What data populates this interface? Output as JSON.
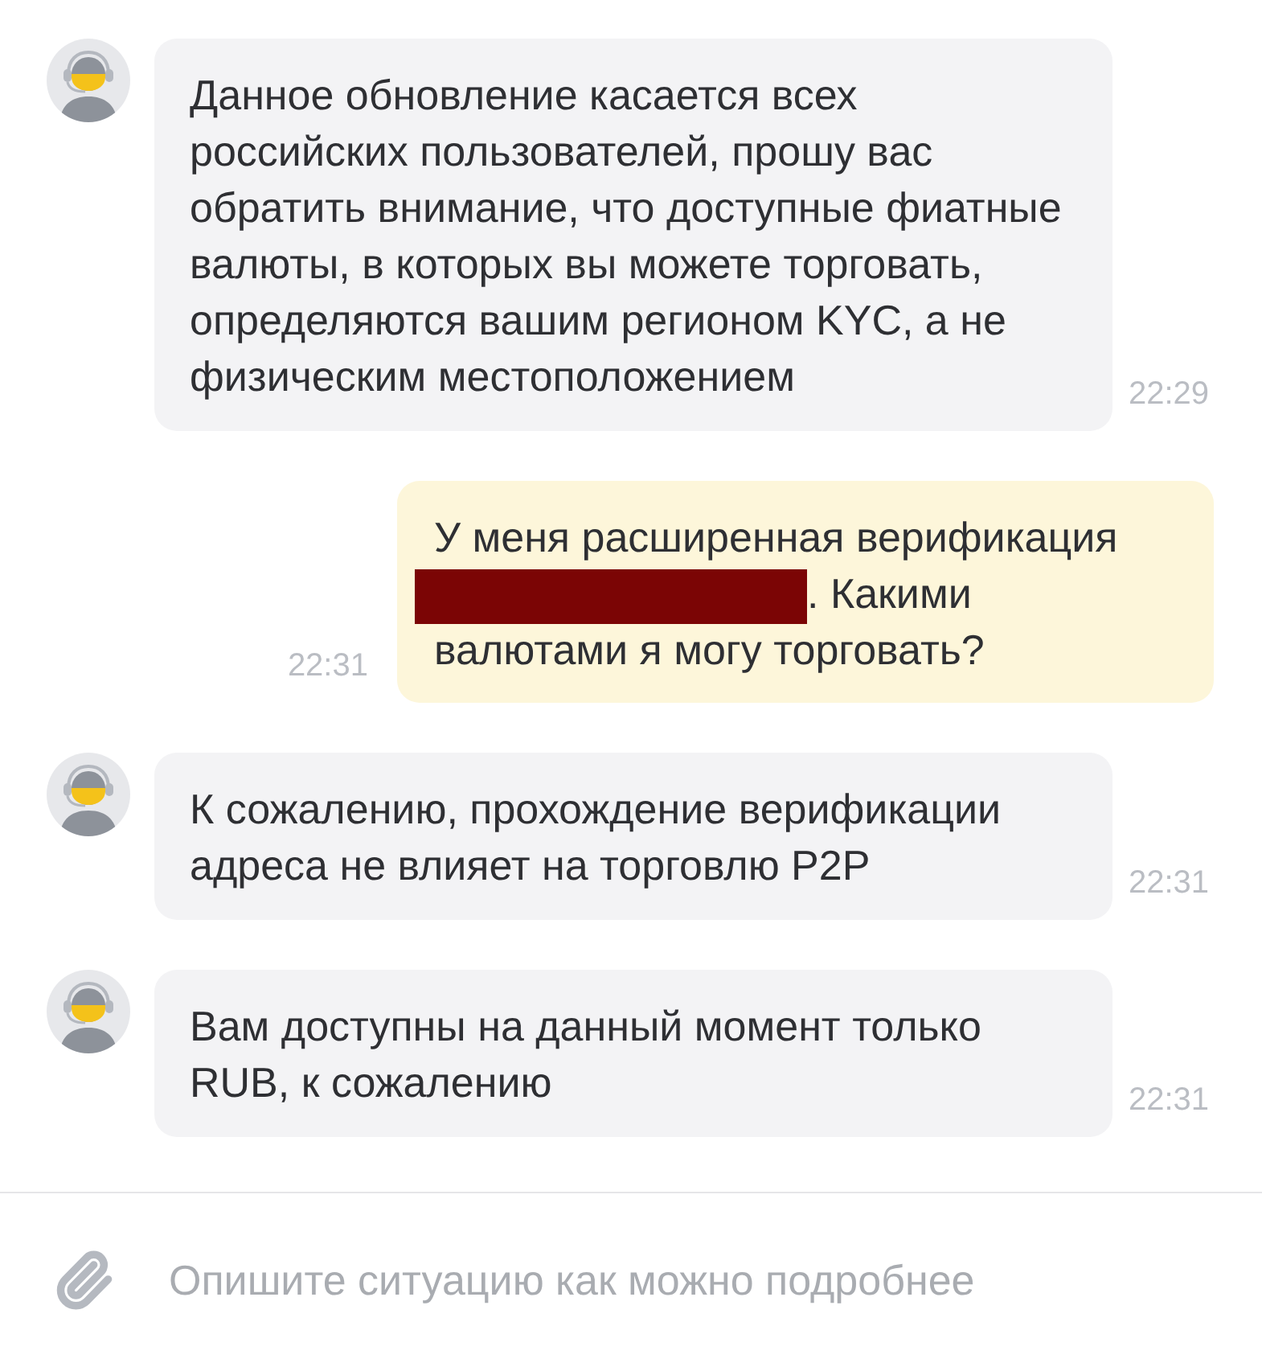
{
  "messages": [
    {
      "kind": "agent",
      "text": "Данное обновление касается всех российских пользователей, прошу вас обратить внимание, что доступные фиатные валюты, в которых вы можете торговать, определяются вашим регионом KYC, а не физическим местоположением",
      "time": "22:29"
    },
    {
      "kind": "user",
      "text_before": "У меня расширенная верификация",
      "redacted": true,
      "text_after": ". Какими валютами я могу торговать?",
      "time": "22:31"
    },
    {
      "kind": "agent",
      "text": "К сожалению, прохождение верификации адреса не влияет на торговлю P2P",
      "time": "22:31"
    },
    {
      "kind": "agent",
      "text": "Вам доступны на данный момент только RUB, к сожалению",
      "time": "22:31"
    }
  ],
  "composer": {
    "placeholder": "Опишите ситуацию как можно подробнее"
  }
}
